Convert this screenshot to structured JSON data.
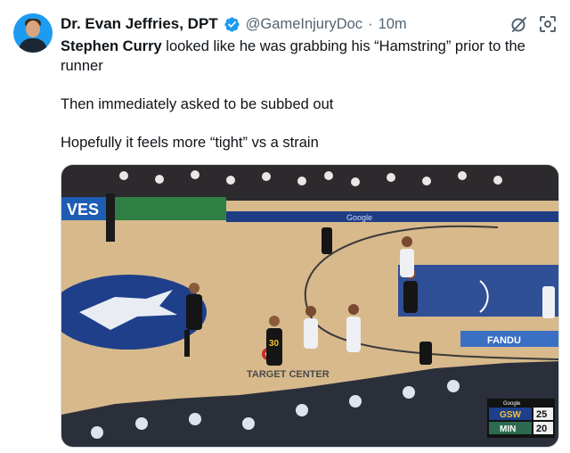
{
  "author": {
    "display_name": "Dr. Evan Jeffries, DPT",
    "handle": "@GameInjuryDoc",
    "separator": "·",
    "time_ago": "10m",
    "verified": true
  },
  "tweet": {
    "mention": "Stephen Curry",
    "line1_rest": " looked like he was grabbing his “Hamstring” prior to the runner",
    "line2": "Then immediately asked to be subbed out",
    "line3": "Hopefully it feels more “tight” vs a strain"
  },
  "actions": {
    "grok_icon": "grok-slash-icon",
    "screenshot_icon": "focus-frame-icon"
  },
  "media": {
    "ad_board_left": "VES",
    "court_logo_text": "TARGET CENTER",
    "baseline_ad": "Google",
    "sideline_ad": "FANDU",
    "jersey_number": "30",
    "scorebug_brand": "Google",
    "scorebug_team1": "GSW",
    "scorebug_score1": "25",
    "scorebug_team2": "MIN",
    "scorebug_score2": "20",
    "colors": {
      "court": "#d7b98c",
      "paint_blue": "#2f4f96",
      "wolves_blue": "#1f3f8a",
      "crowd": "#2c2a2c"
    }
  }
}
